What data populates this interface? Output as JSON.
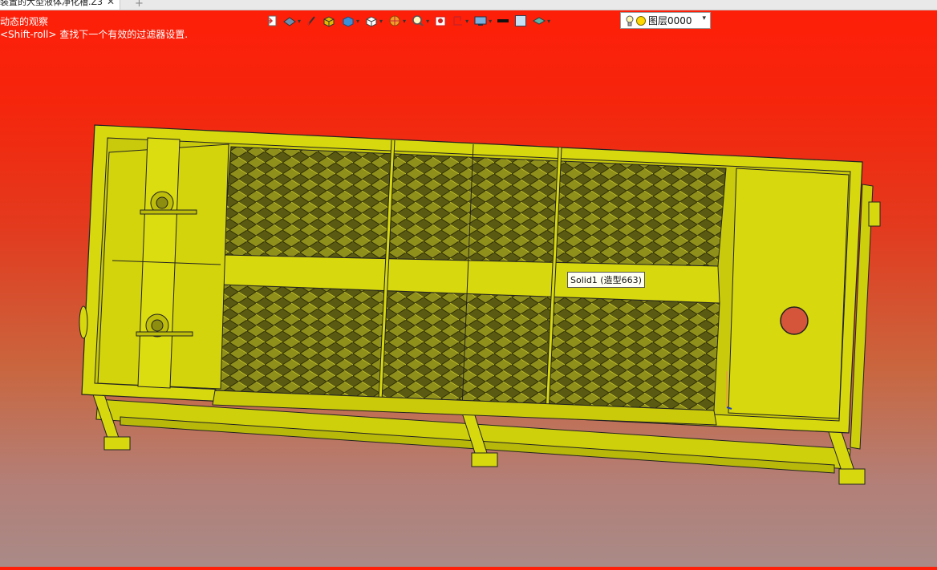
{
  "tab": {
    "title": "装置的大型液体净化槽.Z3",
    "close_glyph": "✕",
    "add_glyph": "+"
  },
  "hints": {
    "line1": "动态的观察",
    "line2": "<Shift-roll> 查找下一个有效的过滤器设置."
  },
  "toolbar": {
    "icons": [
      "exit-sketch-icon",
      "view-orient-icon",
      "pen-icon",
      "shaded-box-icon",
      "blue-box-icon",
      "white-cube-icon",
      "color-wheel-icon",
      "zoom-icon",
      "red-marker-icon",
      "section-icon",
      "display-icon",
      "line-color-icon",
      "fill-color-icon",
      "layer-manager-icon"
    ],
    "layer": {
      "value": "图层0000",
      "dropdown_glyph": "▾"
    }
  },
  "viewport": {
    "tooltip": "Solid1 (造型663)",
    "part_color": "#d7d80d",
    "background_top": "#ff1e08",
    "background_bottom": "#a98a87"
  }
}
